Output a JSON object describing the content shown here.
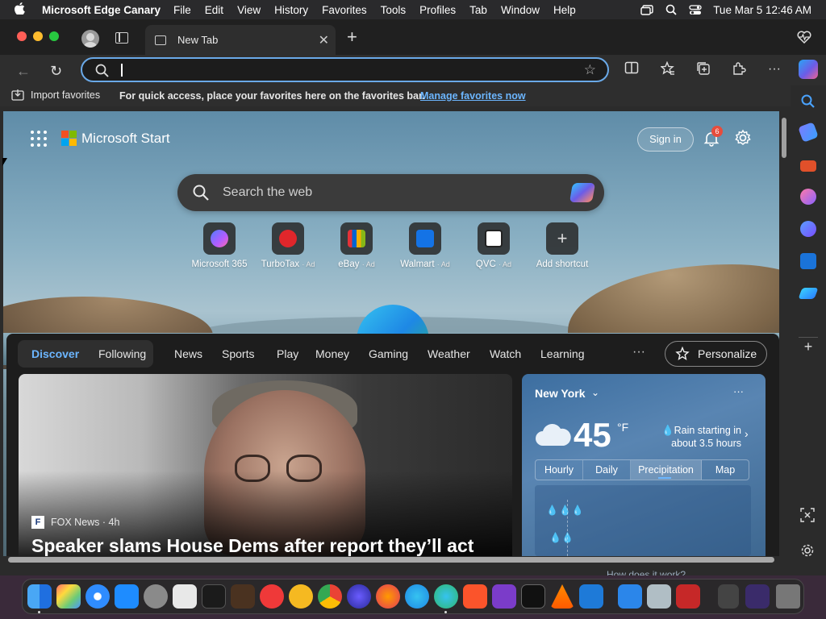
{
  "menubar": {
    "app_name": "Microsoft Edge Canary",
    "items": [
      "File",
      "Edit",
      "View",
      "History",
      "Favorites",
      "Tools",
      "Profiles",
      "Tab",
      "Window",
      "Help"
    ],
    "clock": "Tue Mar 5  12:46 AM"
  },
  "tabstrip": {
    "active_tab_title": "New Tab",
    "close_glyph": "✕",
    "new_tab_glyph": "+"
  },
  "toolbar": {
    "address_value": "",
    "back_glyph": "←",
    "reload_glyph": "↻",
    "favorite_glyph": "☆",
    "more_glyph": "···"
  },
  "favorites_bar": {
    "import_label": "Import favorites",
    "message": "For quick access, place your favorites here on the favorites bar.",
    "manage_link": "Manage favorites now"
  },
  "start_page": {
    "brand": "Microsoft Start",
    "sign_in": "Sign in",
    "notification_count": "6",
    "search_placeholder": "Search the web",
    "shortcuts": [
      {
        "label": "Microsoft 365",
        "ad": "",
        "color": "#7b5cff"
      },
      {
        "label": "TurboTax",
        "ad": "· Ad",
        "color": "#e0262b"
      },
      {
        "label": "eBay",
        "ad": "· Ad",
        "color": "#1b6fd1"
      },
      {
        "label": "Walmart",
        "ad": "· Ad",
        "color": "#1473e6"
      },
      {
        "label": "QVC",
        "ad": "· Ad",
        "color": "#ffffff"
      },
      {
        "label": "Add shortcut",
        "ad": "",
        "color": "#5a5a5a"
      }
    ]
  },
  "feed": {
    "tabs": [
      "Discover",
      "Following",
      "News",
      "Sports",
      "Play",
      "Money",
      "Gaming",
      "Weather",
      "Watch",
      "Learning"
    ],
    "more_glyph": "···",
    "personalize": "Personalize",
    "hero": {
      "source": "FOX News · 4h",
      "source_logo": "F",
      "headline": "Speaker slams House Dems after report they’ll act"
    }
  },
  "weather": {
    "city": "New York",
    "chevron": "⌄",
    "more_glyph": "···",
    "temperature": "45",
    "unit": "°F",
    "forecast_line1": "Rain starting in",
    "forecast_line2": "about 3.5 hours",
    "arrow": "›",
    "tabs": [
      "Hourly",
      "Daily",
      "Precipitation",
      "Map"
    ],
    "active_tab": "Precipitation"
  },
  "bottom_peek": "How does it work?",
  "colors": {
    "accent": "#6cb6ff",
    "omnibox_border": "#6aa9e8",
    "badge": "#e74c3c"
  }
}
